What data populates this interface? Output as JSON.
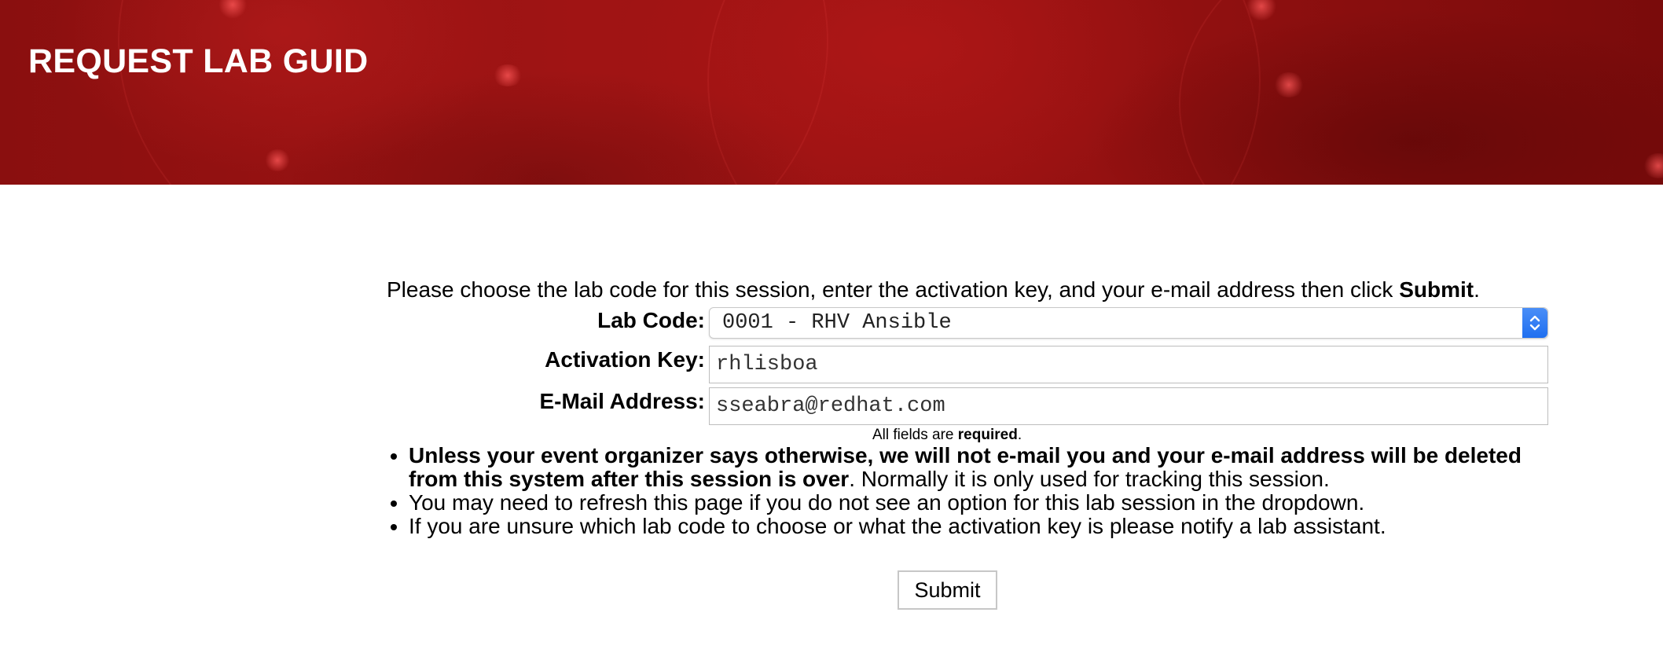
{
  "header": {
    "title": "REQUEST LAB GUID"
  },
  "form": {
    "intro_text": "Please choose the lab code for this session, enter the activation key, and your e-mail address then click ",
    "intro_bold": "Submit",
    "intro_end": ".",
    "lab_code_label": "Lab Code:",
    "lab_code_value": "0001 - RHV Ansible",
    "activation_key_label": "Activation Key:",
    "activation_key_value": "rhlisboa",
    "email_label": "E-Mail Address:",
    "email_value": "sseabra@redhat.com",
    "required_prefix": "All fields are ",
    "required_bold": "required",
    "required_suffix": ".",
    "submit_label": "Submit"
  },
  "notes": [
    {
      "bold": "Unless your event organizer says otherwise, we will not e-mail you and your e-mail address will be deleted from this system after this session is over",
      "text": ". Normally it is only used for tracking this session."
    },
    {
      "bold": "",
      "text": "You may need to refresh this page if you do not see an option for this lab session in the dropdown."
    },
    {
      "bold": "",
      "text": "If you are unsure which lab code to choose or what the activation key is please notify a lab assistant."
    }
  ],
  "colors": {
    "banner": "#9a1212",
    "select_accent": "#1f6ff0"
  },
  "icons": {
    "select_arrow": "chevron-up-down-icon"
  }
}
